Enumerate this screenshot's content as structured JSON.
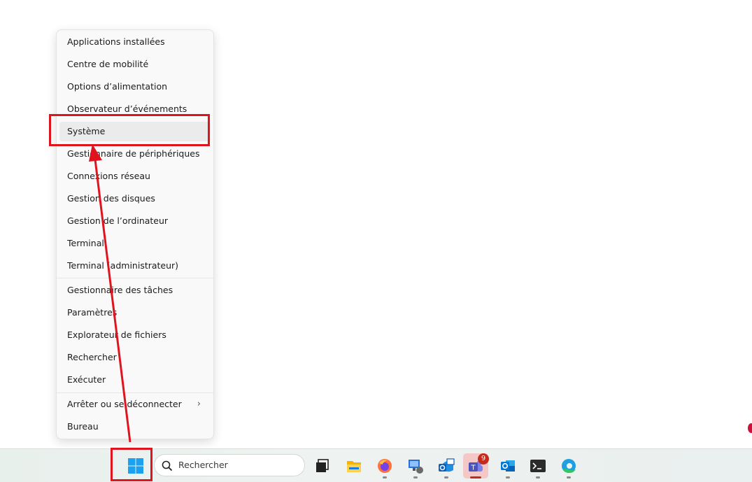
{
  "context_menu": {
    "items": [
      {
        "label": "Applications installées"
      },
      {
        "label": "Centre de mobilité"
      },
      {
        "label": "Options d’alimentation"
      },
      {
        "label": "Observateur d’événements"
      },
      {
        "label": "Système"
      },
      {
        "label": "Gestionnaire de périphériques"
      },
      {
        "label": "Connexions réseau"
      },
      {
        "label": "Gestion des disques"
      },
      {
        "label": "Gestion de l’ordinateur"
      },
      {
        "label": "Terminal"
      },
      {
        "label": "Terminal (administrateur)"
      },
      {
        "label": "Gestionnaire des tâches"
      },
      {
        "label": "Paramètres"
      },
      {
        "label": "Explorateur de fichiers"
      },
      {
        "label": "Rechercher"
      },
      {
        "label": "Exécuter"
      },
      {
        "label": "Arrêter ou se déconnecter",
        "submenu_icon": "chevron-right-icon"
      },
      {
        "label": "Bureau"
      }
    ],
    "highlighted": "Système"
  },
  "taskbar": {
    "search_placeholder": "Rechercher",
    "teams_badge": "9",
    "icons": [
      "windows-start-icon",
      "search-icon",
      "task-view-icon",
      "file-explorer-icon",
      "firefox-icon",
      "remote-desktop-icon",
      "outlook-new-icon",
      "teams-icon",
      "outlook-icon",
      "terminal-icon",
      "edge-icon"
    ]
  },
  "colors": {
    "annotation_red": "#e0141e",
    "menu_bg": "#f9f9f9",
    "badge_red": "#c42b1c"
  }
}
